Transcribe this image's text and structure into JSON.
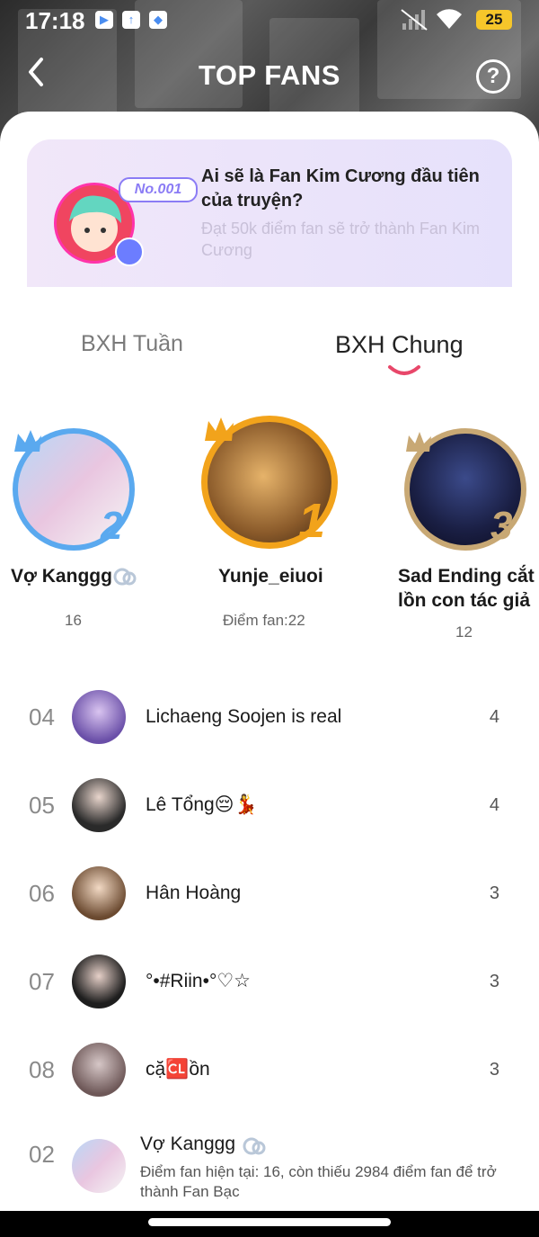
{
  "status": {
    "time": "17:18",
    "battery": "25"
  },
  "header": {
    "title": "TOP FANS",
    "help": "?"
  },
  "banner": {
    "badge": "No.001",
    "title": "Ai sẽ là Fan Kim Cương đầu tiên của truyện?",
    "subtitle": "Đạt 50k điểm fan sẽ trở thành Fan Kim Cương"
  },
  "tabs": {
    "week": "BXH Tuần",
    "general": "BXH Chung",
    "active": "general"
  },
  "podium": {
    "first": {
      "rank": "1",
      "name": "Yunje_eiuoi",
      "score": "Điểm fan:22"
    },
    "second": {
      "rank": "2",
      "name": "Vợ Kanggg",
      "score": "16"
    },
    "third": {
      "rank": "3",
      "name_line1": "Sad Ending cắt",
      "name_line2": "lồn con tác giả",
      "score": "12"
    }
  },
  "list": [
    {
      "rank": "04",
      "name": "Lichaeng Soojen is real",
      "score": "4"
    },
    {
      "rank": "05",
      "name": "Lê Tổng😔💃",
      "score": "4"
    },
    {
      "rank": "06",
      "name": "Hân Hoàng",
      "score": "3"
    },
    {
      "rank": "07",
      "name": "°•#Riin•°♡☆",
      "score": "3"
    },
    {
      "rank": "08",
      "name": "cặ🆑ồn",
      "score": "3"
    }
  ],
  "me": {
    "rank": "02",
    "name": "Vợ Kanggg",
    "info": "Điểm fan hiện tại: 16, còn thiếu 2984 điểm fan để trở thành Fan Bạc"
  },
  "colors": {
    "accent": "#e8476a",
    "gold": "#f2a31b",
    "silver": "#5aa9ef",
    "bronze": "#c8a874"
  }
}
